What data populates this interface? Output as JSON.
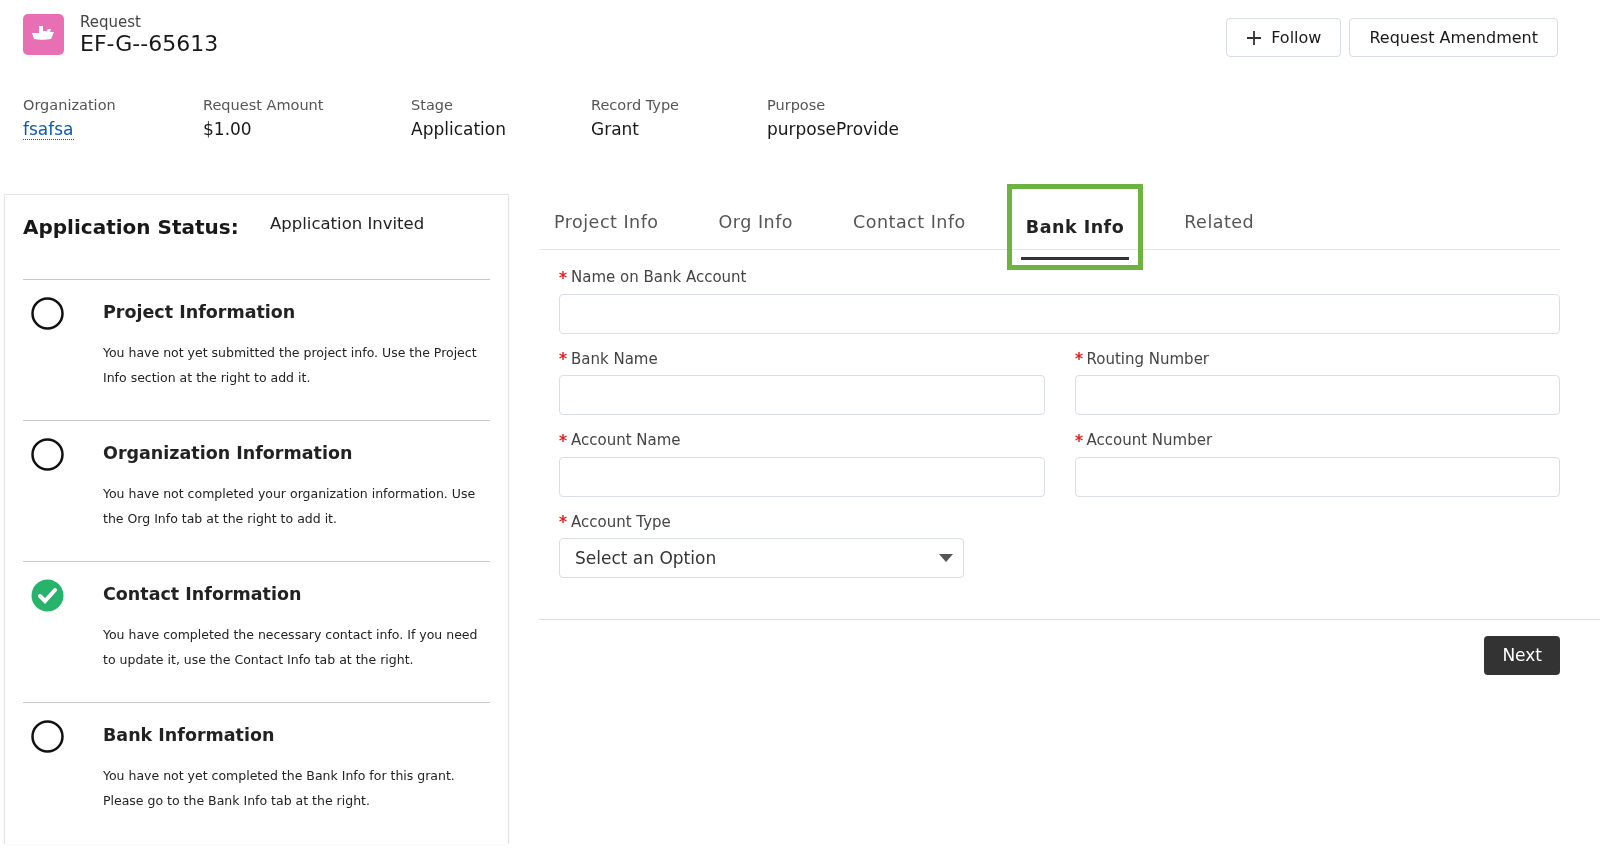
{
  "header": {
    "object_type": "Request",
    "record_name": "EF-G--65613",
    "actions": [
      {
        "label": "Follow",
        "kind": "follow"
      },
      {
        "label": "Request Amendment",
        "kind": "plain"
      }
    ]
  },
  "highlights": [
    {
      "label": "Organization",
      "value": "fsafsa",
      "kind": "link"
    },
    {
      "label": "Request Amount",
      "value": "$1.00",
      "kind": "text"
    },
    {
      "label": "Stage",
      "value": "Application",
      "kind": "text"
    },
    {
      "label": "Record Type",
      "value": "Grant",
      "kind": "text"
    },
    {
      "label": "Purpose",
      "value": "purposeProvide",
      "kind": "text"
    }
  ],
  "status_panel": {
    "title": "Application Status:",
    "status": "Application Invited",
    "steps": [
      {
        "title": "Project Information",
        "text": "You have not yet submitted the project info. Use the Project Info section at the right to add it.",
        "completed": false
      },
      {
        "title": "Organization Information",
        "text": "You have not completed your organization information. Use the Org Info tab at the right to add it.",
        "completed": false
      },
      {
        "title": "Contact Information",
        "text": "You have completed the necessary contact info. If you need to update it, use the Contact Info tab at the right.",
        "completed": true
      },
      {
        "title": "Bank Information",
        "text": "You have not yet completed the Bank Info for this grant. Please go to the Bank Info tab at the right.",
        "completed": false
      }
    ]
  },
  "tabs": [
    {
      "label": "Project Info",
      "selected": false,
      "highlighted": false
    },
    {
      "label": "Org Info",
      "selected": false,
      "highlighted": false
    },
    {
      "label": "Contact Info",
      "selected": false,
      "highlighted": false
    },
    {
      "label": "Bank Info",
      "selected": true,
      "highlighted": true
    },
    {
      "label": "Related",
      "selected": false,
      "highlighted": false
    }
  ],
  "form": {
    "rows": [
      [
        {
          "label": "Name on Bank Account",
          "kind": "text",
          "required": true
        }
      ],
      [
        {
          "label": "Bank Name",
          "kind": "text",
          "required": true
        },
        {
          "label": "Routing Number",
          "kind": "text",
          "required": true
        }
      ],
      [
        {
          "label": "Account Name",
          "kind": "text",
          "required": true
        },
        {
          "label": "Account Number",
          "kind": "text",
          "required": true
        }
      ],
      [
        {
          "label": "Account Type",
          "kind": "select",
          "required": true,
          "value": "Select an Option"
        }
      ]
    ],
    "next_button": "Next"
  }
}
